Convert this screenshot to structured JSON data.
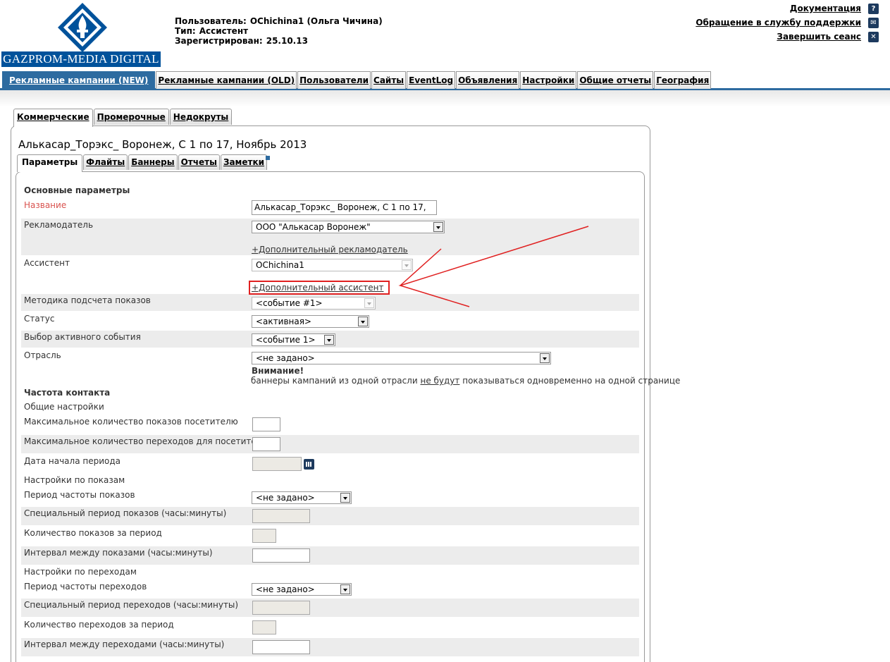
{
  "header": {
    "logo_text": "GAZPROM-MEDIA DIGITAL",
    "user_label": "Пользователь:",
    "user_value": "OChichina1 (Ольга Чичина)",
    "type_label": "Тип:",
    "type_value": "Ассистент",
    "registered_label": "Зарегистрирован:",
    "registered_value": "25.10.13",
    "links": [
      {
        "label": "Документация",
        "icon": "help-icon",
        "glyph": "?"
      },
      {
        "label": "Обращение в службу поддержки",
        "icon": "mail-icon",
        "glyph": "✉"
      },
      {
        "label": "Завершить сеанс",
        "icon": "close-icon",
        "glyph": "✕"
      }
    ]
  },
  "main_tabs": [
    "Рекламные кампании (NEW)",
    "Рекламные кампании (OLD)",
    "Пользователи",
    "Сайты",
    "EventLog",
    "Объявления",
    "Настройки",
    "Общие отчеты",
    "География"
  ],
  "sub_tabs": [
    "Коммерческие",
    "Промерочные",
    "Недокруты"
  ],
  "campaign_title": "Алькасар_Торэкс_ Воронеж, С 1 по 17, Ноябрь 2013",
  "inner_tabs": [
    "Параметры",
    "Флайты",
    "Баннеры",
    "Отчеты",
    "Заметки"
  ],
  "form": {
    "section_main": "Основные параметры",
    "name_label": "Название",
    "name_value": "Алькасар_Торэкс_ Воронеж, С 1 по 17,",
    "advertiser_label": "Рекламодатель",
    "advertiser_value": "ООО \"Алькасар Воронеж\"",
    "add_advertiser": "+Дополнительный рекламодатель",
    "assistant_label": "Ассистент",
    "assistant_value": "OChichina1",
    "add_assistant": "+Дополнительный ассистент",
    "method_label": "Методика подсчета показов",
    "method_value": "<событие #1>",
    "status_label": "Статус",
    "status_value": "<активная>",
    "active_event_label": "Выбор активного события",
    "active_event_value": "<событие 1>",
    "industry_label": "Отрасль",
    "industry_value": "<не задано>",
    "warning_title": "Внимание!",
    "warning_text_1": "баннеры кампаний из одной отрасли ",
    "warning_text_u": "не будут",
    "warning_text_2": " показываться одновременно на одной странице",
    "section_freq": "Частота контакта",
    "general_settings": "Общие настройки",
    "max_shows_label": "Максимальное количество показов посетителю",
    "max_clicks_label": "Максимальное количество переходов для посетителя",
    "start_date_label": "Дата начала периода",
    "show_settings": "Настройки по показам",
    "show_period_label": "Период частоты показов",
    "show_period_value": "<не задано>",
    "special_show_period_label": "Специальный период показов (часы:минуты)",
    "shows_per_period_label": "Количество показов за период",
    "show_interval_label": "Интервал между показами (часы:минуты)",
    "click_settings": "Настройки по переходам",
    "click_period_label": "Период частоты переходов",
    "click_period_value": "<не задано>",
    "special_click_period_label": "Специальный период переходов (часы:минуты)",
    "clicks_per_period_label": "Количество переходов за период",
    "click_interval_label": "Интервал между переходами (часы:минуты)"
  },
  "colors": {
    "accent": "#2d6ba0",
    "annotation": "#e02020",
    "logo_bg": "#00529b"
  }
}
